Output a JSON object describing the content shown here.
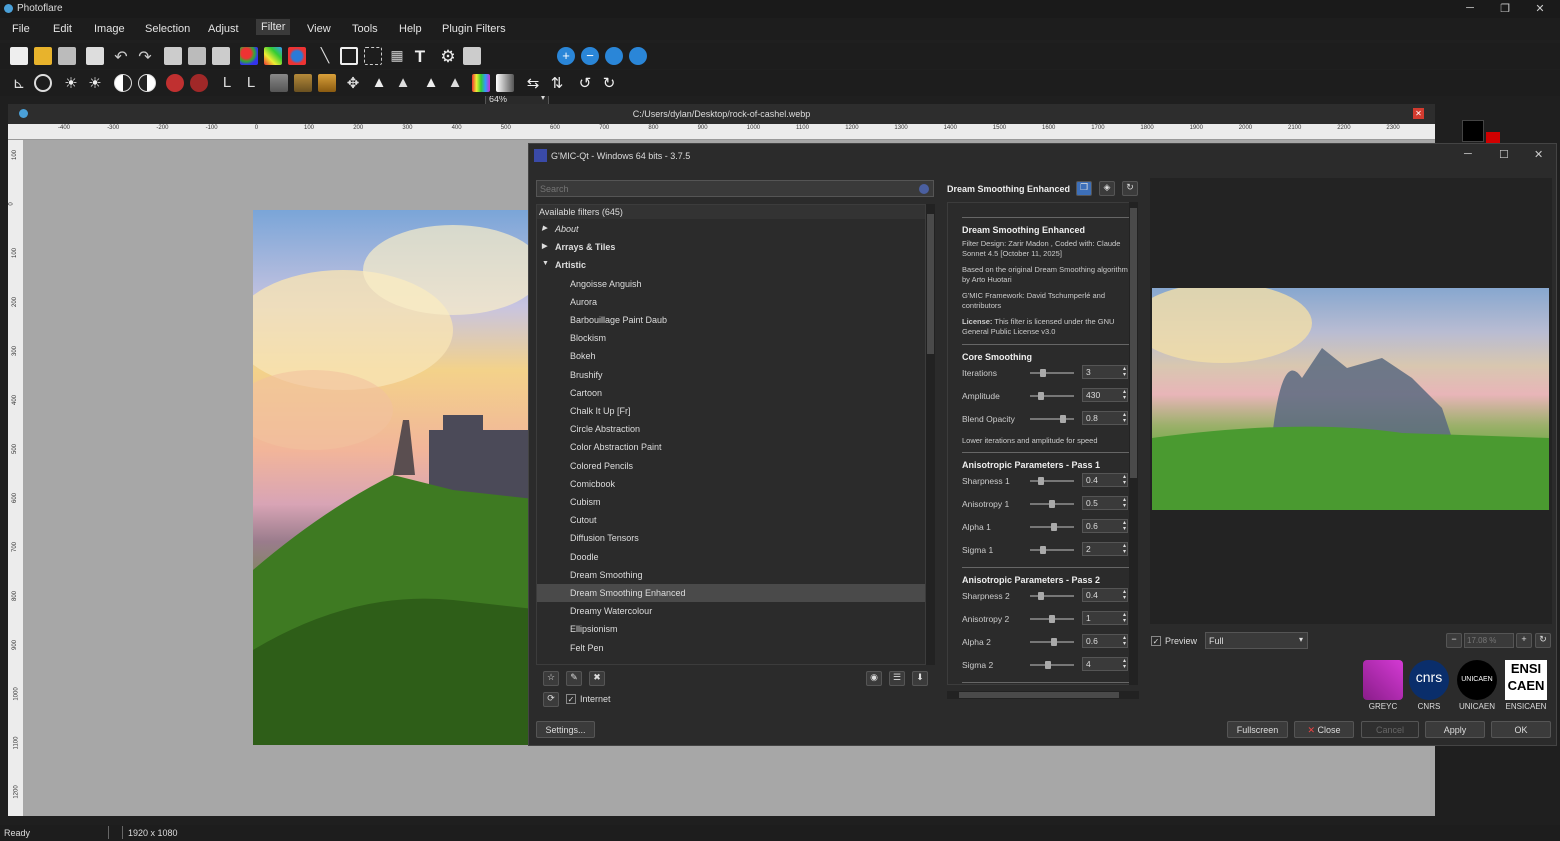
{
  "app": {
    "title": "Photoflare"
  },
  "menu": [
    "File",
    "Edit",
    "Image",
    "Selection",
    "Adjust",
    "Filter",
    "View",
    "Tools",
    "Help",
    "Plugin Filters"
  ],
  "toolbar": {
    "zoom": "64%"
  },
  "document": {
    "path": "C:/Users/dylan/Desktop/rock-of-cashel.webp"
  },
  "ruler": {
    "h": [
      "-400",
      "-300",
      "-200",
      "-100",
      "0",
      "100",
      "200",
      "300",
      "400",
      "500",
      "600",
      "700",
      "800",
      "900",
      "1000",
      "1100",
      "1200",
      "1300",
      "1400",
      "1500",
      "1600",
      "1700",
      "1800",
      "1900",
      "2000",
      "2100",
      "2200",
      "2300"
    ],
    "v": [
      "100",
      "0",
      "100",
      "200",
      "300",
      "400",
      "500",
      "600",
      "700",
      "800",
      "900",
      "1000",
      "1100",
      "1200",
      "1300"
    ]
  },
  "status": {
    "text": "Ready",
    "size": "1920 x 1080"
  },
  "gmic": {
    "title": "G'MIC-Qt - Windows 64 bits - 3.7.5",
    "search_placeholder": "Search",
    "available": "Available filters (645)",
    "categories": [
      "About",
      "Arrays & Tiles",
      "Artistic"
    ],
    "filters": [
      "Angoisse Anguish",
      "Aurora",
      "Barbouillage Paint Daub",
      "Blockism",
      "Bokeh",
      "Brushify",
      "Cartoon",
      "Chalk It Up [Fr]",
      "Circle Abstraction",
      "Color Abstraction Paint",
      "Colored Pencils",
      "Comicbook",
      "Cubism",
      "Cutout",
      "Diffusion Tensors",
      "Doodle",
      "Dream Smoothing",
      "Dream Smoothing Enhanced",
      "Dreamy Watercolour",
      "Ellipsionism",
      "Felt Pen"
    ],
    "internet": "Internet",
    "settings": "Settings...",
    "filter_name": "Dream Smoothing Enhanced",
    "info": {
      "title": "Dream Smoothing Enhanced",
      "design": "Filter Design: Zarir Madon , Coded with: Claude Sonnet 4.5 [October 11, 2025]",
      "based": "Based on the original Dream Smoothing algorithm by Arto Huotari",
      "framework": "G'MIC Framework: David Tschumperlé and contributors",
      "license_label": "License:",
      "license": "This filter is licensed under the GNU General Public License v3.0"
    },
    "sections": [
      "Core Smoothing",
      "Anisotropic Parameters - Pass 1",
      "Anisotropic Parameters - Pass 2"
    ],
    "note": "Lower iterations and amplitude for speed",
    "params": [
      {
        "label": "Iterations",
        "value": "3",
        "pos": 0.25
      },
      {
        "label": "Amplitude",
        "value": "430",
        "pos": 0.22
      },
      {
        "label": "Blend Opacity",
        "value": "0.8",
        "pos": 0.8
      },
      {
        "label": "Sharpness 1",
        "value": "0.4",
        "pos": 0.22
      },
      {
        "label": "Anisotropy 1",
        "value": "0.5",
        "pos": 0.5
      },
      {
        "label": "Alpha 1",
        "value": "0.6",
        "pos": 0.55
      },
      {
        "label": "Sigma 1",
        "value": "2",
        "pos": 0.25
      },
      {
        "label": "Sharpness 2",
        "value": "0.4",
        "pos": 0.22
      },
      {
        "label": "Anisotropy 2",
        "value": "1",
        "pos": 0.5
      },
      {
        "label": "Alpha 2",
        "value": "0.6",
        "pos": 0.55
      },
      {
        "label": "Sigma 2",
        "value": "4",
        "pos": 0.4
      }
    ],
    "preview_label": "Preview",
    "preview_mode": "Full",
    "zoom": "17.08 %",
    "logos": [
      "GREYC",
      "CNRS",
      "UNICAEN",
      "ENSICAEN"
    ],
    "logo_marks": {
      "cnrs": "cnrs",
      "unicaen": "UNICAEN",
      "ensi": "ENSI",
      "caen": "CAEN"
    },
    "buttons": {
      "fullscreen": "Fullscreen",
      "close": "Close",
      "cancel": "Cancel",
      "apply": "Apply",
      "ok": "OK"
    }
  },
  "colors": {
    "accent": "#d10000",
    "bg": "#1f1f1f",
    "panel": "#2b2b2b"
  }
}
